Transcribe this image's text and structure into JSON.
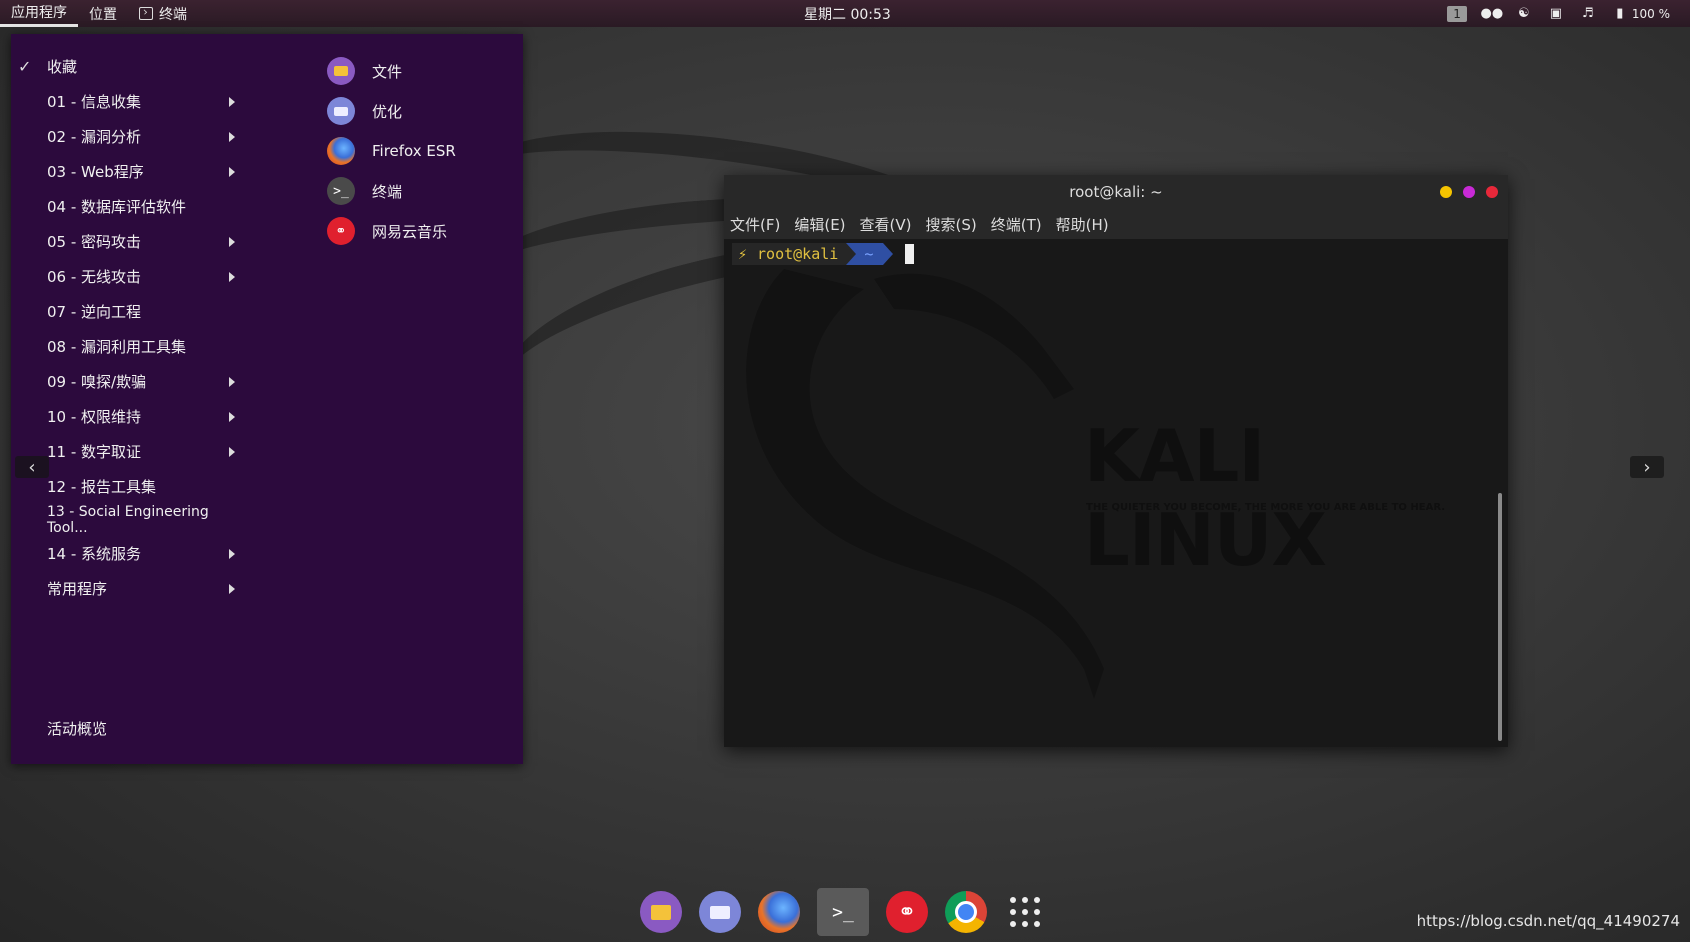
{
  "topbar": {
    "apps_label": "应用程序",
    "places_label": "位置",
    "terminal_label": "终端",
    "clock": "星期二 00:53",
    "workspace": "1",
    "battery": "100 %"
  },
  "menu": {
    "favorites": "收藏",
    "categories": [
      {
        "label": "01 - 信息收集",
        "arrow": true
      },
      {
        "label": "02 - 漏洞分析",
        "arrow": true
      },
      {
        "label": "03 - Web程序",
        "arrow": true
      },
      {
        "label": "04 - 数据库评估软件",
        "arrow": false
      },
      {
        "label": "05 - 密码攻击",
        "arrow": true
      },
      {
        "label": "06 - 无线攻击",
        "arrow": true
      },
      {
        "label": "07 - 逆向工程",
        "arrow": false
      },
      {
        "label": "08 - 漏洞利用工具集",
        "arrow": false
      },
      {
        "label": "09 - 嗅探/欺骗",
        "arrow": true
      },
      {
        "label": "10 - 权限维持",
        "arrow": true
      },
      {
        "label": "11 - 数字取证",
        "arrow": true
      },
      {
        "label": "12 - 报告工具集",
        "arrow": false
      },
      {
        "label": "13 - Social Engineering Tool...",
        "arrow": false
      },
      {
        "label": "14 - 系统服务",
        "arrow": true
      },
      {
        "label": "常用程序",
        "arrow": true
      }
    ],
    "overview": "活动概览",
    "apps": [
      {
        "label": "文件"
      },
      {
        "label": "优化"
      },
      {
        "label": "Firefox ESR"
      },
      {
        "label": "终端"
      },
      {
        "label": "网易云音乐"
      }
    ]
  },
  "terminal": {
    "title": "root@kali: ~",
    "menu": [
      "文件(F)",
      "编辑(E)",
      "查看(V)",
      "搜索(S)",
      "终端(T)",
      "帮助(H)"
    ],
    "prompt_user": "root@kali",
    "prompt_dir": "~",
    "bg_brand": "KALI LINUX",
    "bg_slogan": "THE QUIETER YOU BECOME, THE MORE YOU ARE ABLE TO HEAR."
  },
  "colors": {
    "menu_bg": "#2c0a3d",
    "btn_min": "#f5c400",
    "btn_max": "#c82ad6",
    "btn_close": "#e8283a"
  },
  "watermark": "https://blog.csdn.net/qq_41490274"
}
